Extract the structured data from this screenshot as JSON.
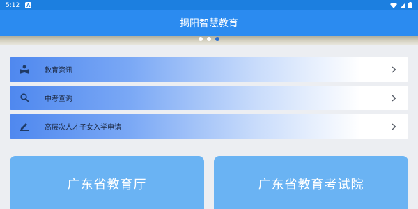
{
  "status_bar": {
    "time": "5:12",
    "notification_icon": "a-notification-icon",
    "icons": [
      "wifi-icon",
      "signal-icon",
      "battery-icon"
    ]
  },
  "app_bar": {
    "title": "揭阳智慧教育"
  },
  "banner": {
    "dots": 3,
    "active_dot": 2
  },
  "menu": {
    "items": [
      {
        "label": "教育资讯",
        "icon": "book-reader-icon"
      },
      {
        "label": "中考查询",
        "icon": "search-icon"
      },
      {
        "label": "高层次人才子女入学申请",
        "icon": "pencil-icon"
      }
    ]
  },
  "cards": [
    {
      "label": "广东省教育厅"
    },
    {
      "label": "广东省教育考试院"
    }
  ],
  "colors": {
    "primary": "#2b8bf0",
    "status_bar": "#1c7fe0",
    "card": "#6ab3f3",
    "background": "#eceef2"
  }
}
